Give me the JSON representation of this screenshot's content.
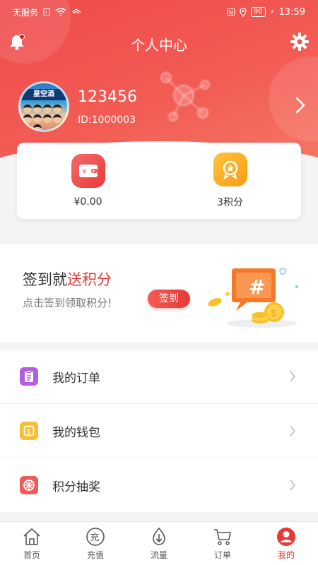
{
  "statusbar": {
    "carrier": "无服务",
    "battery": "90",
    "time": "13:59"
  },
  "header": {
    "title": "个人中心"
  },
  "profile": {
    "name": "123456",
    "id_text": "ID:1000003",
    "avatar_banner": "星空酒"
  },
  "stats": {
    "wallet_value": "¥0.00",
    "points_value": "3积分"
  },
  "signin": {
    "title_prefix": "签到就",
    "title_highlight": "送积分",
    "subtitle": "点击签到领取积分!",
    "button_label": "签到"
  },
  "menu": {
    "items": [
      {
        "label": "我的订单",
        "icon": "clipboard-icon",
        "color": "#b45de0"
      },
      {
        "label": "我的钱包",
        "icon": "wallet-coin-icon",
        "color": "#f7c033"
      },
      {
        "label": "积分抽奖",
        "icon": "prize-wheel-icon",
        "color": "#f05a5a"
      }
    ]
  },
  "tabs": [
    {
      "label": "首页",
      "icon": "home-icon"
    },
    {
      "label": "充值",
      "icon": "recharge-icon"
    },
    {
      "label": "流量",
      "icon": "traffic-icon"
    },
    {
      "label": "订单",
      "icon": "cart-icon"
    },
    {
      "label": "我的",
      "icon": "profile-icon",
      "active": true
    }
  ],
  "colors": {
    "accent": "#e53935",
    "header_gradient_start": "#ef4a4a",
    "header_gradient_end": "#f57a66"
  }
}
